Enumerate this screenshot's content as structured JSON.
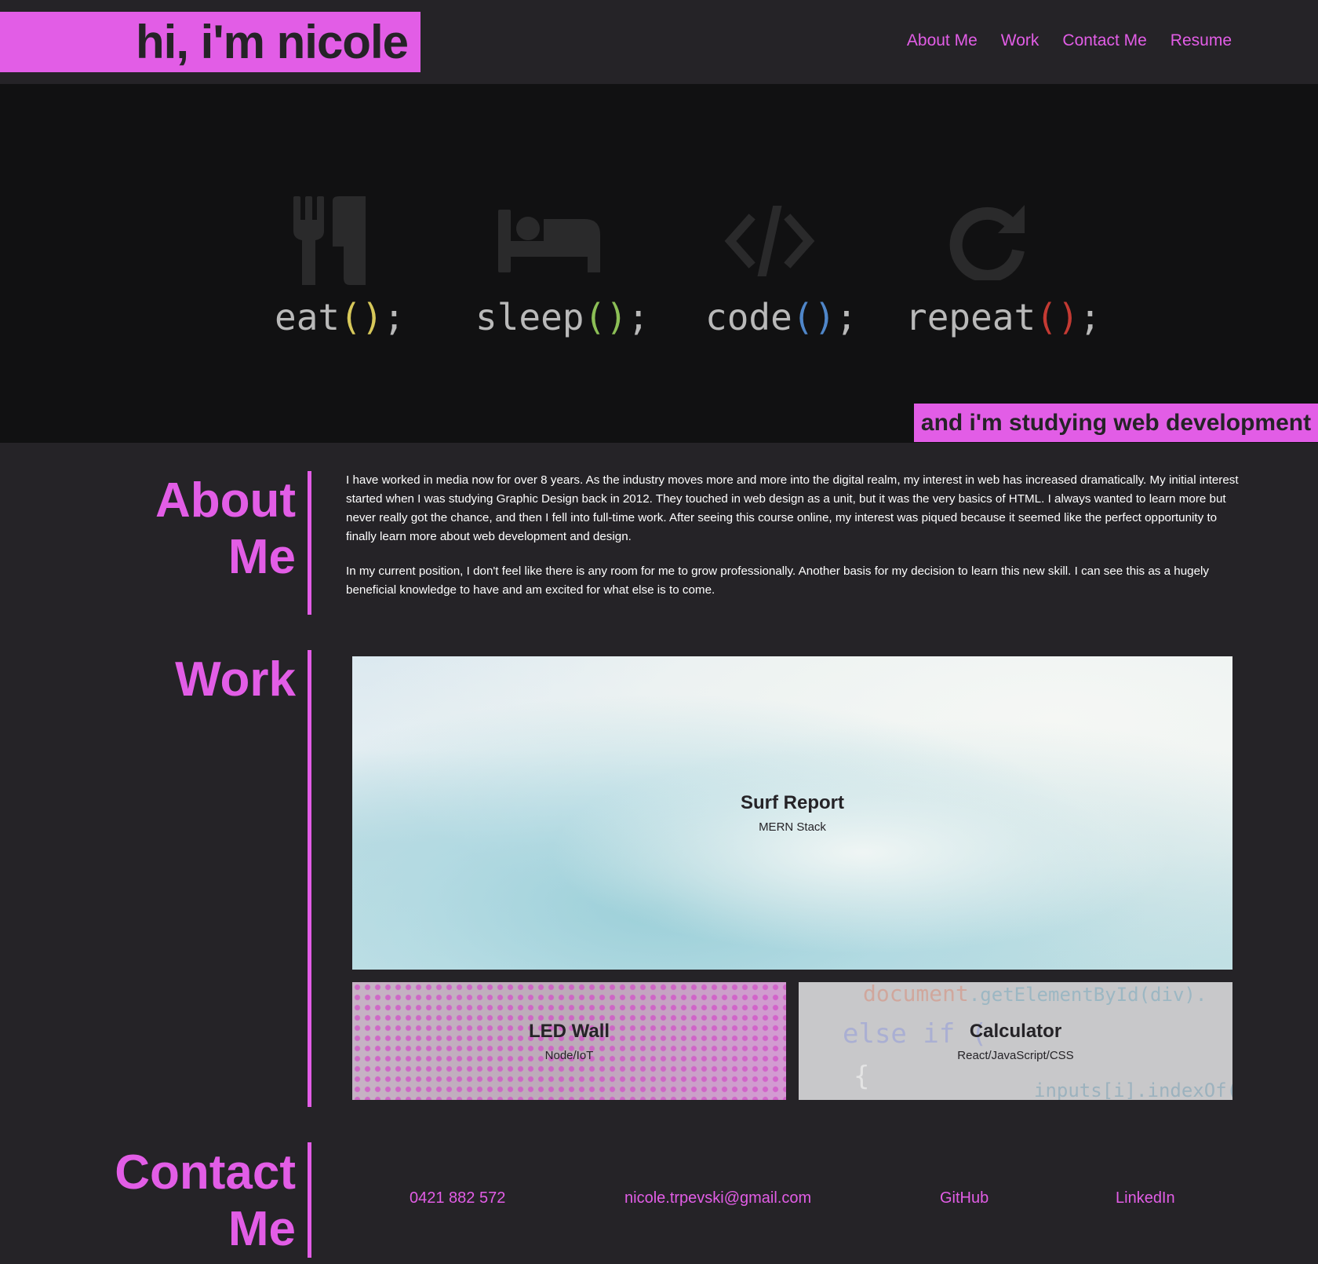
{
  "header": {
    "brand": "hi, i'm nicole",
    "nav": [
      "About Me",
      "Work",
      "Contact Me",
      "Resume"
    ]
  },
  "hero": {
    "items": [
      {
        "word": "eat",
        "icon": "fork-knife-icon"
      },
      {
        "word": "sleep",
        "icon": "bed-icon"
      },
      {
        "word": "code",
        "icon": "code-brackets-icon"
      },
      {
        "word": "repeat",
        "icon": "repeat-arrow-icon"
      }
    ],
    "parens": "()",
    "semicolon": ";",
    "tagline": "and i'm studying web development"
  },
  "about": {
    "title_line1": "About",
    "title_line2": "Me",
    "paragraphs": [
      "I have worked in media now for over 8 years. As the industry moves more and more into the digital realm, my interest in web has increased dramatically. My initial interest started when I was studying Graphic Design back in 2012. They touched in web design as a unit, but it was the very basics of HTML. I always wanted to learn more but never really got the chance, and then I fell into full-time work. After seeing this course online, my interest was piqued because it seemed like the perfect opportunity to finally learn more about web development and design.",
      "In my current position, I don't feel like there is any room for me to grow professionally. Another basis for my decision to learn this new skill. I can see this as a hugely beneficial knowledge to have and am excited for what else is to come."
    ]
  },
  "work": {
    "title": "Work",
    "projects": [
      {
        "title": "Surf Report",
        "stack": "MERN Stack"
      },
      {
        "title": "LED Wall",
        "stack": "Node/IoT"
      },
      {
        "title": "Calculator",
        "stack": "React/JavaScript/CSS"
      }
    ],
    "calculator_code": {
      "line1a": "document",
      "line1b": ".getElementById(div).",
      "line2": "else if (",
      "line3": "{",
      "line4": "inputs[i].indexOf("
    }
  },
  "contact": {
    "title_line1": "Contact",
    "title_line2": "Me",
    "phone": "0421 882 572",
    "email": "nicole.trpevski@gmail.com",
    "github": "GitHub",
    "linkedin": "LinkedIn"
  },
  "colors": {
    "accent": "#e25de6",
    "background": "#252327",
    "hero_background": "#111112"
  }
}
